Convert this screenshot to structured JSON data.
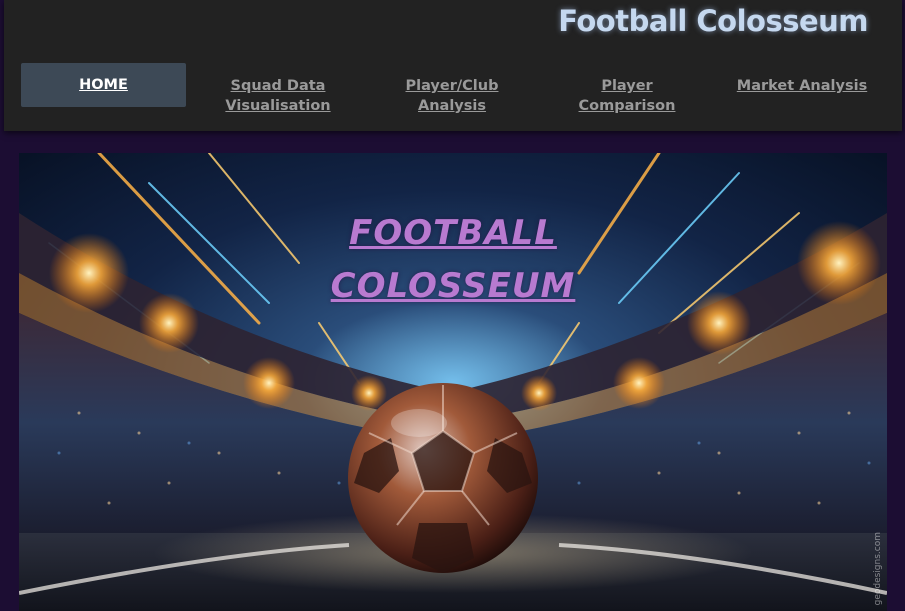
{
  "header": {
    "site_title": "Football Colosseum"
  },
  "nav": {
    "items": [
      {
        "label": "HOME",
        "active": true
      },
      {
        "label": "Squad Data Visualisation",
        "active": false
      },
      {
        "label": "Player/Club Analysis",
        "active": false
      },
      {
        "label": "Player Comparison",
        "active": false
      },
      {
        "label": "Market Analysis",
        "active": false
      }
    ]
  },
  "hero": {
    "title_line1": "FOOTBALL",
    "title_line2": "COLOSSEUM",
    "watermark": "geodesigns.com",
    "colors": {
      "title": "#b87ad0",
      "sky": "#0b1733",
      "lights": "#ffb347"
    }
  },
  "colors": {
    "page_bg": "#1c0d33",
    "header_bg": "#222222",
    "active_tab_bg": "#3d4956",
    "nav_text": "#9a9a9a"
  }
}
